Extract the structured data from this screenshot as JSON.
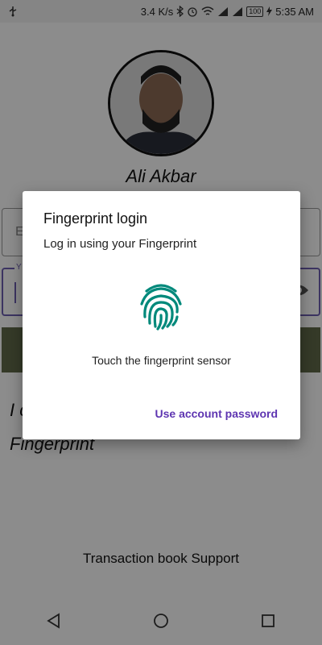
{
  "status_bar": {
    "speed": "3.4 K/s",
    "time": "5:35 AM",
    "battery": "100"
  },
  "profile": {
    "name": "Ali Akbar"
  },
  "email_field": {
    "placeholder": "E"
  },
  "password_field": {
    "label": "Y"
  },
  "fingerprint_text": {
    "line1": "I c",
    "line2": "Fingerprint"
  },
  "footer": {
    "support": "Transaction book Support"
  },
  "dialog": {
    "title": "Fingerprint login",
    "description": "Log in using your Fingerprint",
    "status": "Touch the fingerprint sensor",
    "link_label": "Use account password",
    "accent_color": "#00897b",
    "link_color": "#5e35b1"
  },
  "icons": [
    "usb-icon",
    "bluetooth-icon",
    "alarm-icon",
    "wifi-icon",
    "signal-icon",
    "battery-icon",
    "lightning-icon",
    "eye-icon",
    "fingerprint-icon",
    "back-icon",
    "home-icon",
    "recents-icon"
  ]
}
